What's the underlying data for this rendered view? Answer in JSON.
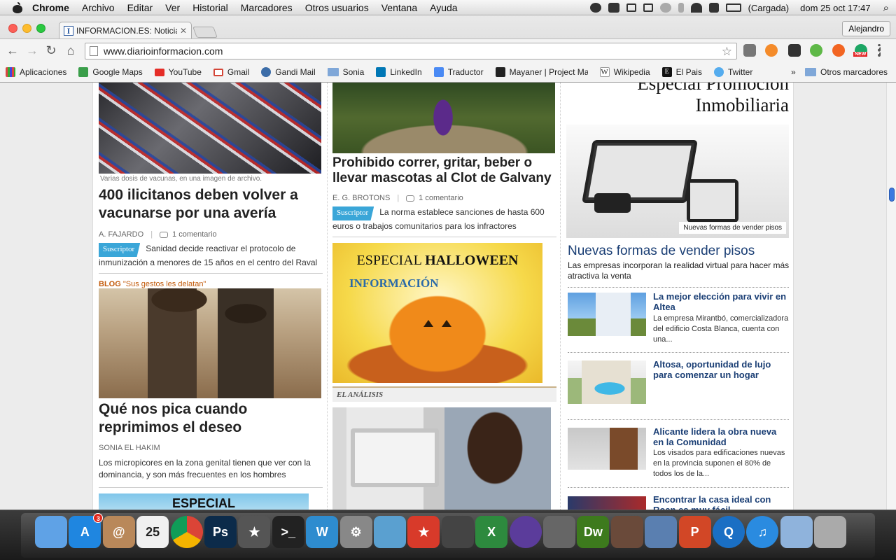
{
  "menubar": {
    "app": "Chrome",
    "menus": [
      "Archivo",
      "Editar",
      "Ver",
      "Historial",
      "Marcadores",
      "Otros usuarios",
      "Ventana",
      "Ayuda"
    ],
    "battery": "(Cargada)",
    "clock": "dom 25 oct  17:47"
  },
  "browser": {
    "tab_title": "INFORMACION.ES: Noticias",
    "tab_favicon": "I",
    "profile": "Alejandro",
    "url": "www.diarioinformacion.com",
    "ext_badge": "NEW"
  },
  "bookmarks": {
    "items": [
      {
        "label": "Aplicaciones",
        "icon": "apps-icon",
        "color": "#d44"
      },
      {
        "label": "Google Maps",
        "icon": "maps-icon",
        "color": "#3a9e4a"
      },
      {
        "label": "YouTube",
        "icon": "youtube-icon",
        "color": "#e52d27"
      },
      {
        "label": "Gmail",
        "icon": "gmail-icon",
        "color": "#d44638"
      },
      {
        "label": "Gandi Mail",
        "icon": "gandi-icon",
        "color": "#3c6da8"
      },
      {
        "label": "Sonia",
        "icon": "folder-icon",
        "color": "#7fa7d8"
      },
      {
        "label": "LinkedIn",
        "icon": "linkedin-icon",
        "color": "#0077b5"
      },
      {
        "label": "Traductor",
        "icon": "translate-icon",
        "color": "#4a8af4"
      },
      {
        "label": "Mayaner | Project Ma",
        "icon": "mayaner-icon",
        "color": "#222"
      },
      {
        "label": "Wikipedia",
        "icon": "wikipedia-icon",
        "color": "#fff"
      },
      {
        "label": "El Pais",
        "icon": "elpais-icon",
        "color": "#111"
      },
      {
        "label": "Twitter",
        "icon": "twitter-icon",
        "color": "#55acee"
      }
    ],
    "more": "»",
    "other": "Otros marcadores"
  },
  "page": {
    "left": {
      "caption": "Varias dosis de vacunas, en una imagen de archivo.",
      "headline1": "400 ilicitanos deben volver a vacunarse por una avería",
      "author1": "A. FAJARDO",
      "comments1": "1 comentario",
      "badge": "Suscriptor",
      "lead1": "Sanidad decide reactivar el protocolo de inmunización a menores de 15 años en el centro del Raval",
      "blog_label": "BLOG",
      "blog_name": "\"Sus gestos les delatan\"",
      "headline2": "Qué nos pica cuando reprimimos el deseo",
      "author2": "SONIA EL HAKIM",
      "lead2": "Los micropicores en la zona genital tienen que ver con la dominancia, y son más frecuentes en los hombres",
      "especial": "ESPECIAL"
    },
    "middle": {
      "headline": "Prohibido correr, gritar, beber o llevar mascotas al Clot de Galvany",
      "author": "E. G. BROTONS",
      "comments": "1 comentario",
      "badge": "Suscriptor",
      "lead": "La norma establece sanciones de hasta 600 euros o trabajos comunitarios para los infractores",
      "ad_especial": "ESPECIAL",
      "ad_halloween": "HALLOWEEN",
      "ad_brand": "INFORMACIÓN",
      "section": "EL ANÁLISIS"
    },
    "right": {
      "promo_line1": "Especial Promoción",
      "promo_line2": "Inmobiliaria",
      "img_caption": "Nuevas formas de vender pisos",
      "main_title": "Nuevas formas de vender pisos",
      "main_lead": "Las empresas incorporan la realidad virtual para hacer más atractiva la venta",
      "items": [
        {
          "title": "La mejor elección para vivir en Altea",
          "text": "La empresa Mirantbó, comercializadora del edificio Costa Blanca, cuenta con una..."
        },
        {
          "title": "Altosa, oportunidad de lujo para comenzar un hogar",
          "text": ""
        },
        {
          "title": "Alicante lidera la obra nueva en la Comunidad",
          "text": "Los visados para edificaciones nuevas en la provincia suponen el 80% de todos los de la..."
        },
        {
          "title": "Encontrar la casa ideal con Roan es muy fácil",
          "text": ""
        }
      ]
    }
  },
  "dock": {
    "apps": [
      {
        "name": "finder-icon",
        "label": "",
        "color": "#5fa2e6"
      },
      {
        "name": "app-store-icon",
        "label": "A",
        "color": "#1f86e0",
        "badge": "3"
      },
      {
        "name": "contacts-icon",
        "label": "@",
        "color": "#b9885a"
      },
      {
        "name": "calendar-icon",
        "label": "25",
        "color": "#f0f0f0"
      },
      {
        "name": "chrome-icon",
        "label": "",
        "color": "#e7b225"
      },
      {
        "name": "photoshop-icon",
        "label": "Ps",
        "color": "#0c2b4a"
      },
      {
        "name": "imovie-icon",
        "label": "★",
        "color": "#555"
      },
      {
        "name": "terminal-icon",
        "label": ">_",
        "color": "#222"
      },
      {
        "name": "wunderlist-icon",
        "label": "W",
        "color": "#2e8ccf"
      },
      {
        "name": "system-preferences-icon",
        "label": "⚙",
        "color": "#888"
      },
      {
        "name": "preview-icon",
        "label": "",
        "color": "#5aa0d0"
      },
      {
        "name": "wunderkit-icon",
        "label": "★",
        "color": "#d83a2a"
      },
      {
        "name": "photo-booth-icon",
        "label": "",
        "color": "#444"
      },
      {
        "name": "excel-icon",
        "label": "X",
        "color": "#2d8a3e"
      },
      {
        "name": "eclipse-icon",
        "label": "",
        "color": "#5b3c9b"
      },
      {
        "name": "dashboard-icon",
        "label": "",
        "color": "#666"
      },
      {
        "name": "dreamweaver-icon",
        "label": "Dw",
        "color": "#3d7a1d"
      },
      {
        "name": "photo-app-icon",
        "label": "",
        "color": "#6a4a3a"
      },
      {
        "name": "iphoto-icon",
        "label": "",
        "color": "#5a7fb0"
      },
      {
        "name": "powerpoint-icon",
        "label": "P",
        "color": "#d24726"
      },
      {
        "name": "quicktime-icon",
        "label": "Q",
        "color": "#1a6fc4"
      },
      {
        "name": "itunes-icon",
        "label": "♫",
        "color": "#2a8be0"
      },
      {
        "name": "applications-folder-icon",
        "label": "",
        "color": "#8fb3dc"
      },
      {
        "name": "trash-icon",
        "label": "",
        "color": "#aaa"
      }
    ]
  }
}
